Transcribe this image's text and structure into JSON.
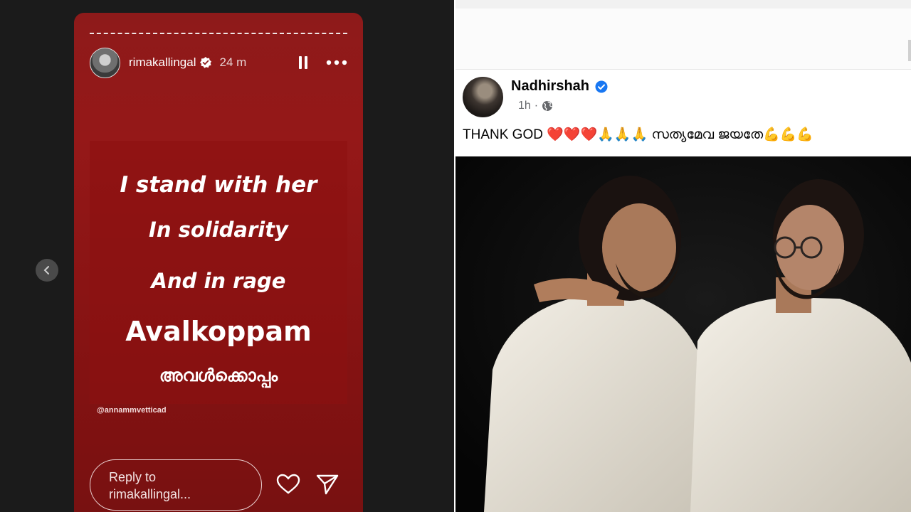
{
  "story": {
    "username": "rimakallingal",
    "time_ago": "24 m",
    "lines": [
      "I stand with her",
      "In solidarity",
      "And in rage",
      "Avalkoppam",
      "അവൾക്കൊപ്പം"
    ],
    "mention": "@annammvetticad",
    "reply_placeholder_line1": "Reply to",
    "reply_placeholder_line2": "rimakallingal...",
    "background_color": "#8e1a1a"
  },
  "post": {
    "author": "Nadhirshah",
    "time_ago": "1h",
    "separator": "·",
    "text": "THANK GOD ❤️❤️❤️🙏🙏🙏 സത്യമേവ ജയതേ💪💪💪",
    "verified_color": "#1877f2"
  }
}
